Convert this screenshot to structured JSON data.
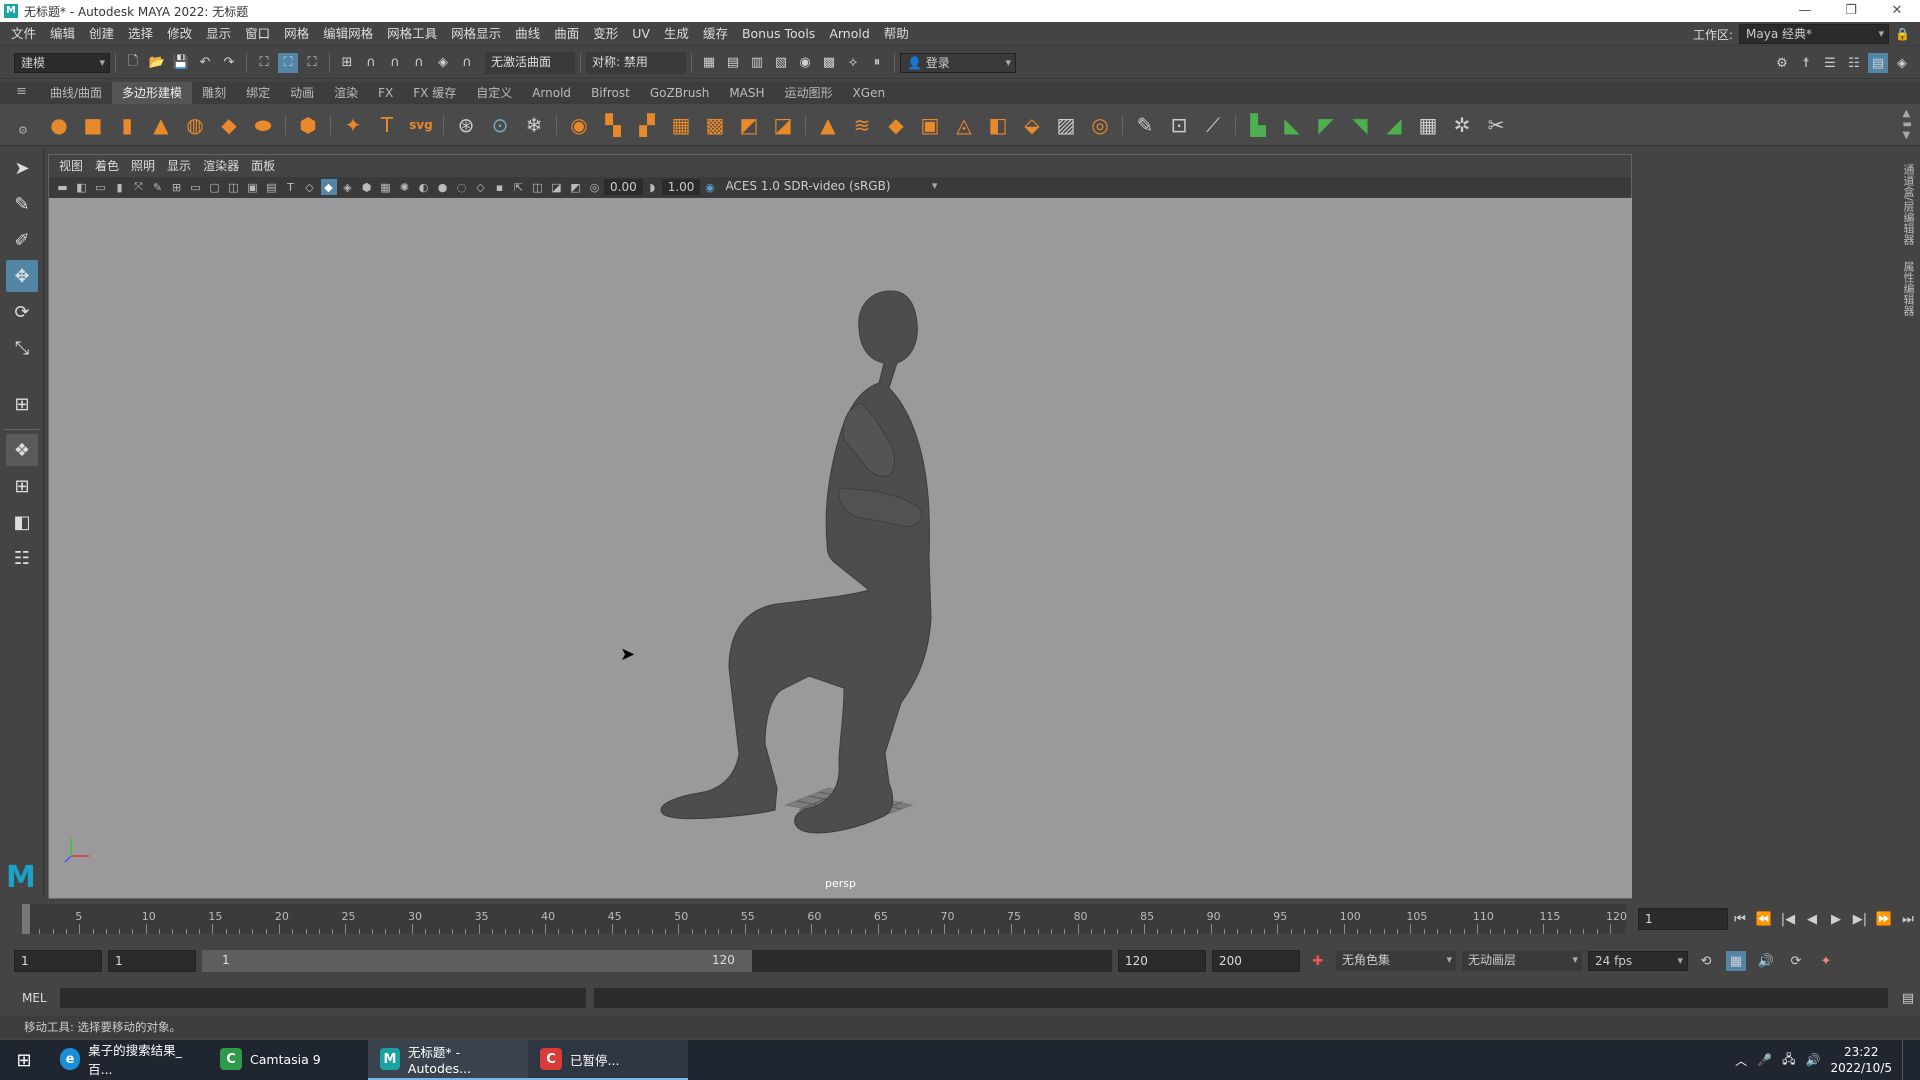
{
  "window": {
    "title": "无标题* - Autodesk MAYA 2022: 无标题",
    "logo": "M",
    "minimize": "—",
    "restore": "❐",
    "close": "✕"
  },
  "menu": [
    "文件",
    "编辑",
    "创建",
    "选择",
    "修改",
    "显示",
    "窗口",
    "网格",
    "编辑网格",
    "网格工具",
    "网格显示",
    "曲线",
    "曲面",
    "变形",
    "UV",
    "生成",
    "缓存",
    "Bonus Tools",
    "Arnold",
    "帮助"
  ],
  "workspace": {
    "label": "工作区:",
    "value": "Maya 经典*"
  },
  "statusline": {
    "mode": "建模",
    "live_surface": "无激活曲面",
    "symmetry": "对称: 禁用",
    "login": "登录"
  },
  "shelf_tabs": [
    "曲线/曲面",
    "多边形建模",
    "雕刻",
    "绑定",
    "动画",
    "渲染",
    "FX",
    "FX 缓存",
    "自定义",
    "Arnold",
    "Bifrost",
    "GoZBrush",
    "MASH",
    "运动图形",
    "XGen"
  ],
  "shelf_active": 1,
  "viewport": {
    "menu": [
      "视图",
      "着色",
      "照明",
      "显示",
      "渲染器",
      "面板"
    ],
    "exposure": "0.00",
    "gamma": "1.00",
    "colorspace": "ACES 1.0 SDR-video (sRGB)",
    "camera": "persp"
  },
  "side_panels": [
    "通道盒/层编辑器",
    "属性编辑器"
  ],
  "timeline": {
    "ticks": [
      "1",
      "5",
      "10",
      "15",
      "20",
      "25",
      "30",
      "35",
      "40",
      "45",
      "50",
      "55",
      "60",
      "65",
      "70",
      "75",
      "80",
      "85",
      "90",
      "95",
      "100",
      "105",
      "110",
      "115",
      "120"
    ],
    "current_frame": "1"
  },
  "range": {
    "start": "1",
    "anim_start": "1",
    "slider_start": "1",
    "slider_end": "120",
    "end": "120",
    "anim_end": "200",
    "character_set": "无角色集",
    "anim_layer": "无动画层",
    "fps": "24 fps"
  },
  "cmdline": {
    "label": "MEL"
  },
  "helpline": "移动工具: 选择要移动的对象。",
  "taskbar": {
    "apps": [
      {
        "label": "桌子的搜索结果_百...",
        "icon": "e"
      },
      {
        "label": "Camtasia 9",
        "icon": "C"
      },
      {
        "label": "无标题* - Autodes...",
        "icon": "M"
      },
      {
        "label": "已暂停...",
        "icon": "C"
      }
    ],
    "time": "23:22",
    "date": "2022/10/5"
  },
  "colors": {
    "accent": "#5285a6",
    "viewport_bg": "#9a9a9d",
    "model": "#4a4a4a"
  }
}
